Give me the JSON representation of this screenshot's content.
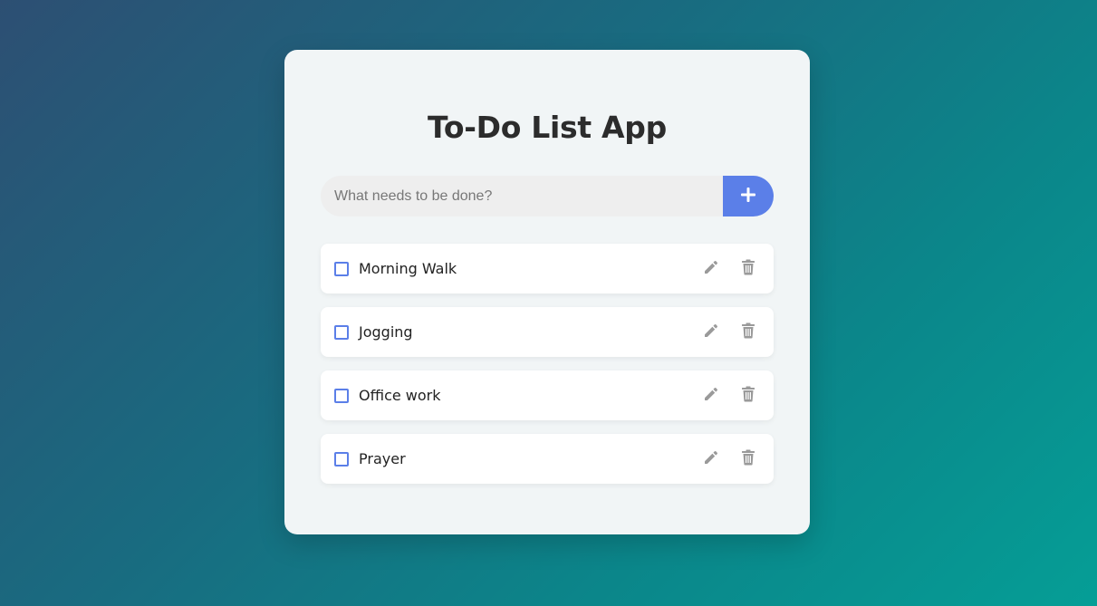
{
  "app": {
    "title": "To-Do List App"
  },
  "add_form": {
    "placeholder": "What needs to be done?",
    "value": "",
    "add_button_icon": "plus-icon"
  },
  "tasks": [
    {
      "label": "Morning Walk",
      "completed": false
    },
    {
      "label": "Jogging",
      "completed": false
    },
    {
      "label": "Office work",
      "completed": false
    },
    {
      "label": "Prayer",
      "completed": false
    }
  ],
  "icons": {
    "edit": "pencil-icon",
    "delete": "trash-icon"
  },
  "colors": {
    "accent": "#5b7fe8",
    "icon_gray": "#9a9a9a",
    "card_bg": "#f1f5f6",
    "bg_start": "#2d4f73",
    "bg_end": "#059e96"
  }
}
